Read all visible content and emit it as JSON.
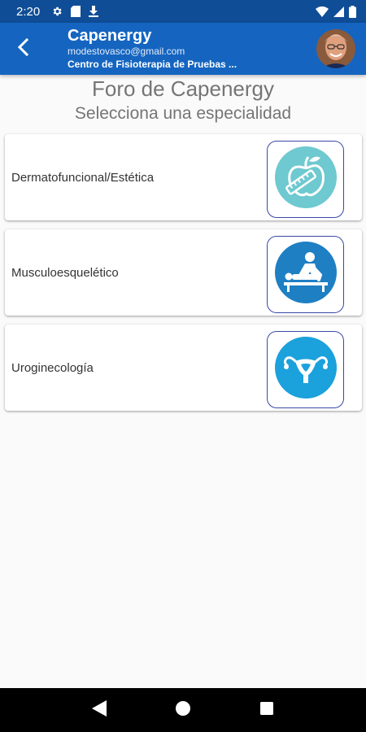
{
  "status_bar": {
    "time": "2:20"
  },
  "header": {
    "title": "Capenergy",
    "email": "modestovasco@gmail.com",
    "center": "Centro de Fisioterapia de Pruebas ..."
  },
  "page": {
    "title": "Foro de Capenergy",
    "subtitle": "Selecciona una especialidad"
  },
  "specialties": [
    {
      "label": "Dermatofuncional/Estética",
      "icon": "apple-tape-measure-icon",
      "color": "#6ec9d0"
    },
    {
      "label": "Musculoesquelético",
      "icon": "physiotherapy-massage-icon",
      "color": "#1e7fc3"
    },
    {
      "label": "Uroginecología",
      "icon": "uterus-icon",
      "color": "#1ba1dc"
    }
  ],
  "colors": {
    "status_bar": "#0f4d97",
    "app_bar": "#1565c0",
    "nav_bar": "#000000"
  }
}
